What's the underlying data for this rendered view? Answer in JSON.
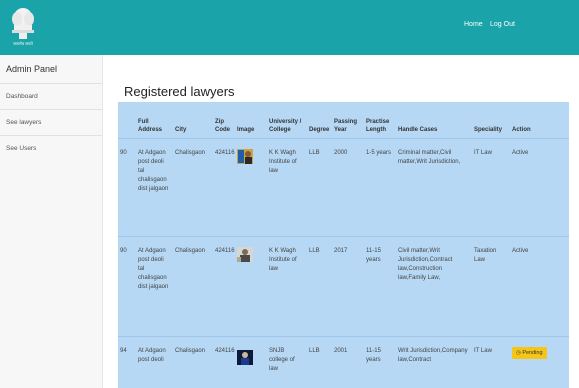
{
  "nav": {
    "home": "Home",
    "logout": "Log Out"
  },
  "logo": {
    "caption": "सत्यमेव जयते"
  },
  "sidebar": {
    "heading": "Admin Panel",
    "items": [
      {
        "label": "Dashboard"
      },
      {
        "label": "See lawyers"
      },
      {
        "label": "See Users"
      }
    ]
  },
  "page": {
    "title": "Registered lawyers"
  },
  "table": {
    "headers": [
      "",
      "Full Address",
      "City",
      "Zip Code",
      "Image",
      "University / College",
      "Degree",
      "Passing Year",
      "Practise Length",
      "Handle Cases",
      "Speciality",
      "Action"
    ],
    "rows": [
      {
        "id": "90",
        "address": "At Adgaon post deoli tal chalisgaon dist jalgaon",
        "city": "Chalisgaon",
        "zip": "424116",
        "university": "K K Wagh Institute of law",
        "degree": "LLB",
        "year": "2000",
        "length": "1-5 years",
        "cases": "Criminal matter,Civil matter,Writ Jurisdiction,",
        "speciality": "IT Law",
        "action": "Active"
      },
      {
        "id": "90",
        "address": "At Adgaon post deoli tal chalisgaon dist jalgaon",
        "city": "Chalisgaon",
        "zip": "424116",
        "university": "K K Wagh Institute of law",
        "degree": "LLB",
        "year": "2017",
        "length": "11-15 years",
        "cases": "Civil matter,Writ Jurisdiction,Contract law,Construction law,Family Law,",
        "speciality": "Taxation Law",
        "action": "Active"
      },
      {
        "id": "94",
        "address": "At Adgaon post deoli",
        "city": "Chalisgaon",
        "zip": "424116",
        "university": "SNJB college of law",
        "degree": "LLB",
        "year": "2001",
        "length": "11-15 years",
        "cases": "Writ Jurisdiction,Company law,Contract",
        "speciality": "IT Law",
        "action": "Pending"
      }
    ]
  },
  "colors": {
    "topbar": "#1aa3a8",
    "table_bg": "#b6d8f5",
    "pending": "#f5c518"
  }
}
